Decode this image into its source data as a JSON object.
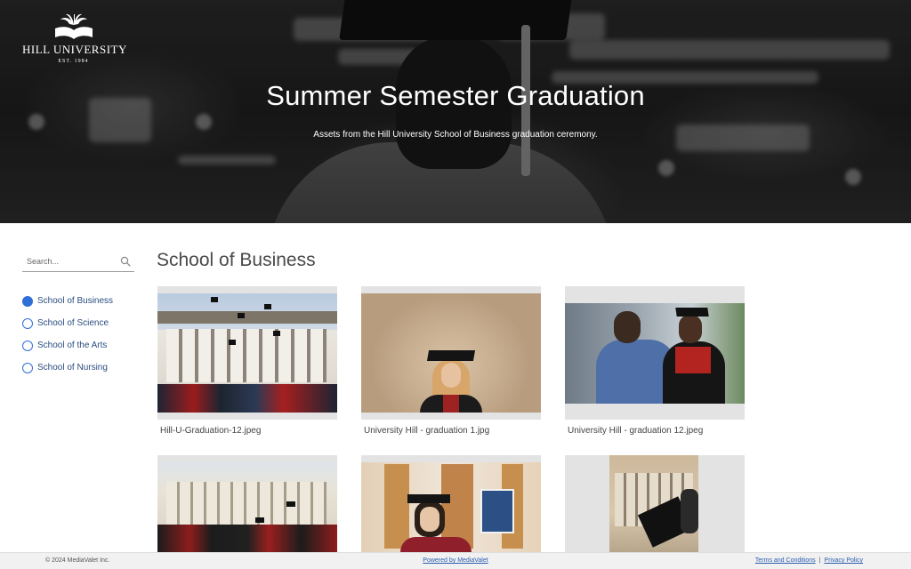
{
  "hero": {
    "logo_name": "HILL UNIVERSITY",
    "logo_est": "EST. 1984",
    "title": "Summer Semester Graduation",
    "subtitle": "Assets from the Hill University School of Business graduation ceremony."
  },
  "sidebar": {
    "search_placeholder": "Search...",
    "categories": [
      {
        "label": "School of Business",
        "selected": true
      },
      {
        "label": "School of Science",
        "selected": false
      },
      {
        "label": "School of the Arts",
        "selected": false
      },
      {
        "label": "School of Nursing",
        "selected": false
      }
    ]
  },
  "main": {
    "section_title": "School of Business",
    "assets": [
      {
        "filename": "Hill-U-Graduation-12.jpeg"
      },
      {
        "filename": "University Hill - graduation 1.jpg"
      },
      {
        "filename": "University Hill - graduation 12.jpeg"
      },
      {
        "filename": ""
      },
      {
        "filename": ""
      },
      {
        "filename": ""
      }
    ]
  },
  "footer": {
    "copyright": "© 2024 MediaValet Inc.",
    "powered_by": "Powered by MediaValet",
    "terms": "Terms and Conditions",
    "privacy": "Privacy Policy"
  },
  "colors": {
    "accent": "#2f6fd6",
    "link": "#2a5db0",
    "footer_bg": "#f1f1f1"
  }
}
